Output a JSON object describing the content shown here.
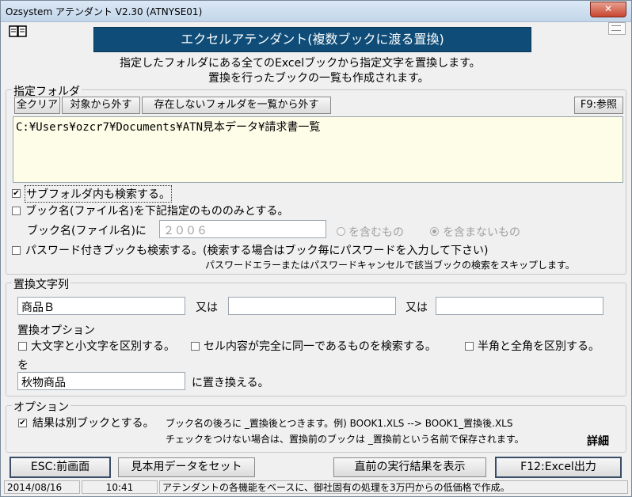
{
  "window": {
    "title": "Ozsystem アテンダント V2.30 (ATNYSE01)",
    "close_glyph": "✕"
  },
  "banner": {
    "title": "エクセルアテンダント(複数ブックに渡る置換)"
  },
  "description": {
    "line1": "指定したフォルダにある全てのExcelブックから指定文字を置換します。",
    "line2": "置換を行ったブックの一覧も作成されます。"
  },
  "folder_group": {
    "label": "指定フォルダ",
    "clear_label": "全クリア",
    "exclude_label": "対象から外す",
    "remove_missing_label": "存在しないフォルダを一覧から外す",
    "browse_label": "F9:参照",
    "folders": [
      "C:¥Users¥ozcr7¥Documents¥ATN見本データ¥請求書一覧"
    ]
  },
  "options_top": {
    "subfolder_label": "サブフォルダ内も検索する。",
    "subfolder_checked": true,
    "bookname_filter_label": "ブック名(ファイル名)を下記指定のもののみとする。",
    "bookname_filter_checked": false,
    "bookname_prefix": "ブック名(ファイル名)に",
    "bookname_value": "２００６",
    "contains_label": "を含むもの",
    "not_contains_label": "を含まないもの",
    "password_label": "パスワード付きブックも検索する。(検索する場合はブック毎にパスワードを入力して下さい)",
    "password_checked": false,
    "password_note": "パスワードエラーまたはパスワードキャンセルで該当ブックの検索をスキップします。"
  },
  "replace_group": {
    "label": "置換文字列",
    "term1": "商品Ｂ",
    "or_label1": "又は",
    "term2": "",
    "or_label2": "又は",
    "term3": "",
    "options_label": "置換オプション",
    "case_label": "大文字と小文字を区別する。",
    "exact_label": "セル内容が完全に同一であるものを検索する。",
    "width_label": "半角と全角を区別する。",
    "with_label": "を",
    "replacement": "秋物商品",
    "replace_suffix": "に置き換える。"
  },
  "option_group": {
    "label": "オプション",
    "separate_book_label": "結果は別ブックとする。",
    "separate_book_checked": true,
    "note1": "ブック名の後ろに _置換後とつきます。例) BOOK1.XLS --> BOOK1_置換後.XLS",
    "note2": "チェックをつけない場合は、置換前のブックは _置換前という名前で保存されます。",
    "detail_label": "詳細"
  },
  "bottom_buttons": {
    "esc_label": "ESC:前画面",
    "sample_label": "見本用データをセット",
    "last_result_label": "直前の実行結果を表示",
    "excel_label": "F12:Excel出力"
  },
  "status": {
    "date": "2014/08/16",
    "time": "10:41",
    "message": "アテンダントの各機能をベースに、御社固有の処理を3万円からの低価格で作成。"
  }
}
